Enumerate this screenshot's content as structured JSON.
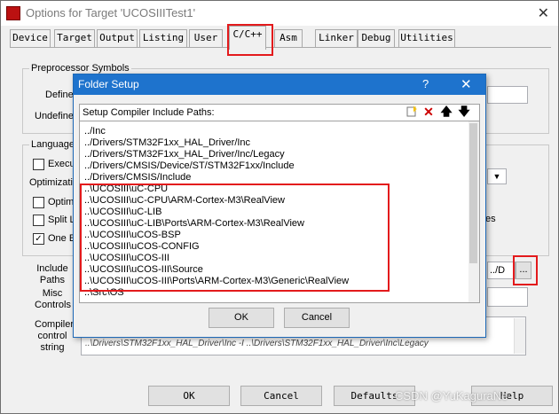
{
  "window": {
    "title": "Options for Target 'UCOSIIITest1'",
    "close_glyph": "✕"
  },
  "tabs": [
    "Device",
    "Target",
    "Output",
    "Listing",
    "User",
    "C/C++",
    "Asm",
    "Linker",
    "Debug",
    "Utilities"
  ],
  "active_tab": "C/C++",
  "preprocessor": {
    "group_label": "Preprocessor Symbols",
    "define_label": "Define",
    "undefine_label": "Undefine"
  },
  "language": {
    "group_label": "Language",
    "execute_label": "Execu",
    "optimization_label": "Optimization",
    "optimize_label": "Optimi",
    "split_label": "Split L",
    "one_elf_label": "One E",
    "right_tail": "es",
    "right_edge_label": "O"
  },
  "include": {
    "label": "Include\nPaths",
    "field_tail": "../D",
    "browse_label": "...",
    "misc_label": "Misc\nControls",
    "compiler_label": "Compiler\ncontrol\nstring",
    "compiler_text": "..\\Drivers\\STM32F1xx_HAL_Driver\\Inc -I ..\\Drivers\\STM32F1xx_HAL_Driver\\Inc\\Legacy"
  },
  "bottom_buttons": {
    "ok": "OK",
    "cancel": "Cancel",
    "defaults": "Defaults",
    "help": "Help"
  },
  "watermark": "CSDN @YuKaguraNe",
  "dialog": {
    "title": "Folder Setup",
    "help_glyph": "?",
    "close_glyph": "✕",
    "header_label": "Setup Compiler Include Paths:",
    "toolbar": [
      "new-folder-icon",
      "delete-icon",
      "move-up-icon",
      "move-down-icon"
    ],
    "paths": [
      "../Inc",
      "../Drivers/STM32F1xx_HAL_Driver/Inc",
      "../Drivers/STM32F1xx_HAL_Driver/Inc/Legacy",
      "../Drivers/CMSIS/Device/ST/STM32F1xx/Include",
      "../Drivers/CMSIS/Include",
      "..\\UCOSIII\\uC-CPU",
      "..\\UCOSIII\\uC-CPU\\ARM-Cortex-M3\\RealView",
      "..\\UCOSIII\\uC-LIB",
      "..\\UCOSIII\\uC-LIB\\Ports\\ARM-Cortex-M3\\RealView",
      "..\\UCOSIII\\uCOS-BSP",
      "..\\UCOSIII\\uCOS-CONFIG",
      "..\\UCOSIII\\uCOS-III",
      "..\\UCOSIII\\uCOS-III\\Source",
      "..\\UCOSIII\\uCOS-III\\Ports\\ARM-Cortex-M3\\Generic\\RealView",
      "..\\Src\\OS"
    ],
    "ok": "OK",
    "cancel": "Cancel"
  }
}
